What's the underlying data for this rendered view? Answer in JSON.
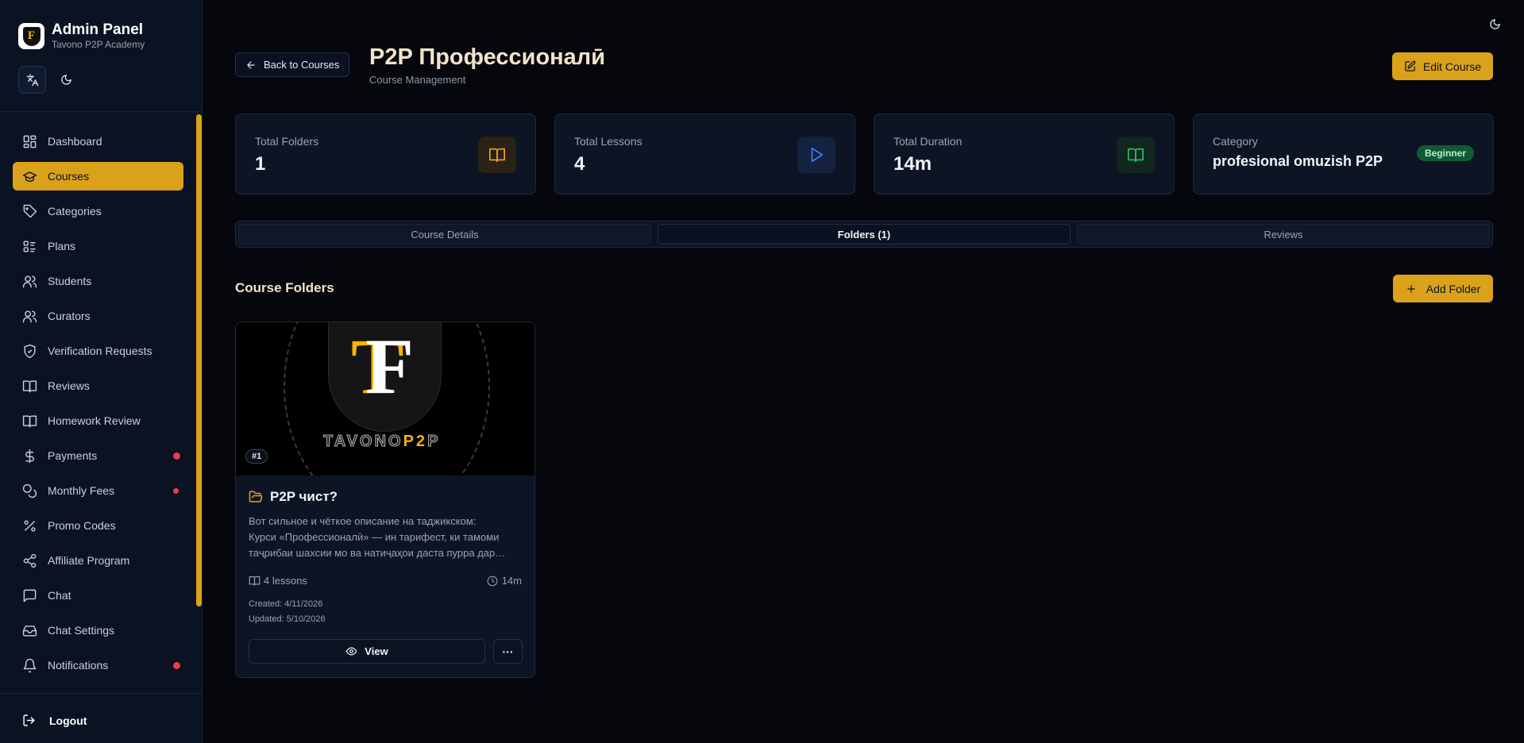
{
  "colors": {
    "accent": "#d9a21a",
    "background": "#05070d",
    "sidebar": "#0b1222",
    "alert_dot": "#ef3a4f",
    "badge_green": "#0f5a34"
  },
  "sidebar": {
    "title": "Admin Panel",
    "subtitle": "Tavono P2P Academy",
    "logo_letter": "F",
    "items": [
      {
        "label": "Dashboard",
        "icon": "dashboard-icon"
      },
      {
        "label": "Courses",
        "icon": "graduation-cap-icon",
        "active": true
      },
      {
        "label": "Categories",
        "icon": "tag-icon"
      },
      {
        "label": "Plans",
        "icon": "list-icon"
      },
      {
        "label": "Students",
        "icon": "users-icon"
      },
      {
        "label": "Curators",
        "icon": "users-icon"
      },
      {
        "label": "Verification Requests",
        "icon": "shield-check-icon"
      },
      {
        "label": "Reviews",
        "icon": "book-open-icon"
      },
      {
        "label": "Homework Review",
        "icon": "book-open-icon"
      },
      {
        "label": "Payments",
        "icon": "dollar-icon",
        "alert": true
      },
      {
        "label": "Monthly Fees",
        "icon": "coins-icon",
        "alert": true
      },
      {
        "label": "Promo Codes",
        "icon": "percent-icon"
      },
      {
        "label": "Affiliate Program",
        "icon": "share-icon"
      },
      {
        "label": "Chat",
        "icon": "chat-icon"
      },
      {
        "label": "Chat Settings",
        "icon": "inbox-icon"
      },
      {
        "label": "Notifications",
        "icon": "bell-icon",
        "alert": true
      }
    ],
    "logout": "Logout"
  },
  "header": {
    "back_label": "Back to Courses",
    "title": "P2P Профессионалӣ",
    "subtitle": "Course Management",
    "edit_label": "Edit Course"
  },
  "stats": {
    "folders": {
      "label": "Total Folders",
      "value": "1"
    },
    "lessons": {
      "label": "Total Lessons",
      "value": "4"
    },
    "duration": {
      "label": "Total Duration",
      "value": "14m"
    },
    "category": {
      "label": "Category",
      "value": "profesional omuzish P2P",
      "badge": "Beginner"
    }
  },
  "tabs": [
    {
      "label": "Course Details"
    },
    {
      "label": "Folders (1)",
      "active": true
    },
    {
      "label": "Reviews"
    }
  ],
  "folders_section": {
    "title": "Course Folders",
    "add_label": "Add Folder",
    "folders": [
      {
        "number": "#1",
        "image_text": {
          "letters": "TF",
          "wordmark_a": "TAVONO",
          "wordmark_b": "P2",
          "wordmark_c": "P"
        },
        "title": "P2P чист?",
        "description_lines": [
          "Вот сильное и чёткое описание на таджикском:",
          "Курси «Профессионалӣ» — ин тарифест, ки тамоми",
          "таҷрибаи шахсии мо ва натиҷаҳои даста пурра дар…"
        ],
        "lessons": "4 lessons",
        "duration": "14m",
        "created": "Created: 4/11/2026",
        "updated": "Updated: 5/10/2026",
        "view_label": "View",
        "more_label": "···"
      }
    ]
  }
}
